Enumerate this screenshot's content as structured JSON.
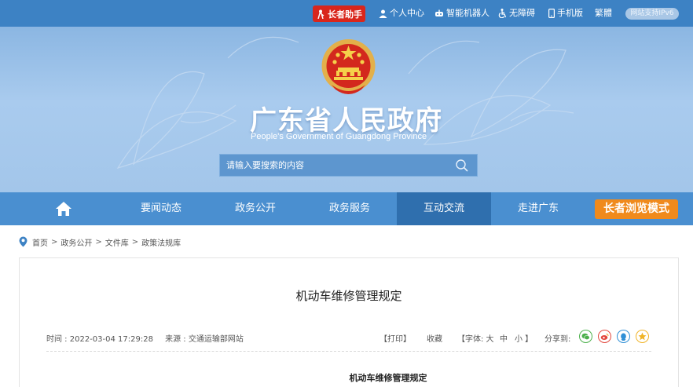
{
  "topbar": {
    "elder_assistant": "长者助手",
    "personal_center": "个人中心",
    "robot": "智能机器人",
    "accessibility": "无障碍",
    "mobile": "手机版",
    "traditional": "繁體",
    "ipv6": "网站支持IPv6"
  },
  "banner": {
    "title": "广东省人民政府",
    "subtitle": "People's Government of Guangdong Province",
    "search_placeholder": "请输入要搜索的内容"
  },
  "nav": {
    "items": [
      {
        "label": "要闻动态"
      },
      {
        "label": "政务公开"
      },
      {
        "label": "政务服务"
      },
      {
        "label": "互动交流"
      },
      {
        "label": "走进广东"
      }
    ],
    "active": "互动交流",
    "elder_mode": "长者浏览模式"
  },
  "breadcrumb": [
    "首页",
    "政务公开",
    "文件库",
    "政策法规库"
  ],
  "article": {
    "title": "机动车维修管理规定",
    "time": "时间 : 2022-03-04 17:29:28",
    "source": "来源 : 交通运输部网站",
    "print": "【打印】",
    "favorite": "收藏",
    "font_label": "【字体: 大",
    "font_mid": "中",
    "font_small": "小 】",
    "share_label": "分享到:",
    "body_title": "机动车维修管理规定"
  },
  "colors": {
    "topbar": "#3d82c4",
    "nav": "#4a8fd0",
    "nav_active": "#2f6fae",
    "elder_red": "#d9261c",
    "elder_orange": "#f08a1c"
  },
  "icons": [
    "person-icon",
    "robot-icon",
    "accessibility-icon",
    "phone-icon",
    "search-icon",
    "home-icon",
    "location-pin-icon",
    "wechat-icon",
    "weibo-icon",
    "qq-icon",
    "qzone-icon"
  ]
}
